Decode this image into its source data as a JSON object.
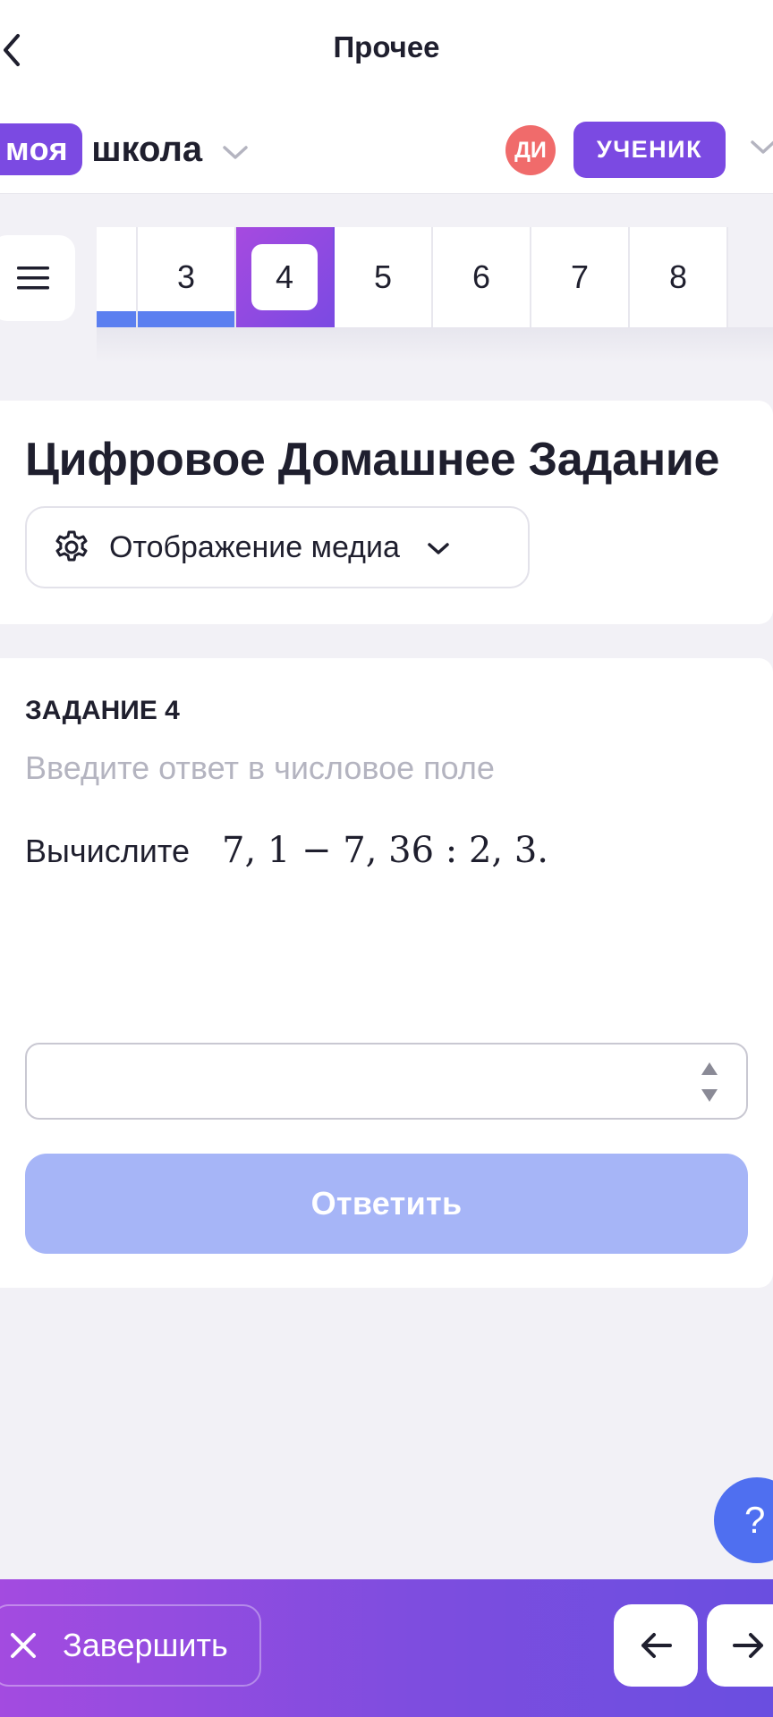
{
  "header": {
    "title": "Прочее",
    "brand_highlight": "моя",
    "brand_name": "школа",
    "avatar_initials": "ДИ",
    "role": "УЧЕНИК"
  },
  "tabs": [
    {
      "label": "",
      "state": "done"
    },
    {
      "label": "3",
      "state": "done"
    },
    {
      "label": "4",
      "state": "active"
    },
    {
      "label": "5",
      "state": "todo"
    },
    {
      "label": "6",
      "state": "todo"
    },
    {
      "label": "7",
      "state": "todo"
    },
    {
      "label": "8",
      "state": "todo"
    }
  ],
  "homework": {
    "title": "Цифровое Домашнее Задание",
    "media_label": "Отображение медиа"
  },
  "task": {
    "label": "ЗАДАНИЕ 4",
    "hint": "Введите ответ в числовое поле",
    "prompt": "Вычислите",
    "expression": "7, 1 − 7, 36 : 2, 3.",
    "answer_value": "",
    "submit_label": "Ответить"
  },
  "help": {
    "label": "?"
  },
  "footer": {
    "finish_label": "Завершить"
  },
  "colors": {
    "brand": "#7b4ae2",
    "avatar": "#f06b6b",
    "progress": "#5b7ff0",
    "submit_disabled": "#a6b5f7",
    "help": "#4f6ff0"
  },
  "icons": {
    "back": "chevron-left-icon",
    "menu": "hamburger-icon",
    "media": "gear-icon",
    "finish": "close-icon",
    "prev": "arrow-left-icon",
    "next": "arrow-right-icon"
  }
}
